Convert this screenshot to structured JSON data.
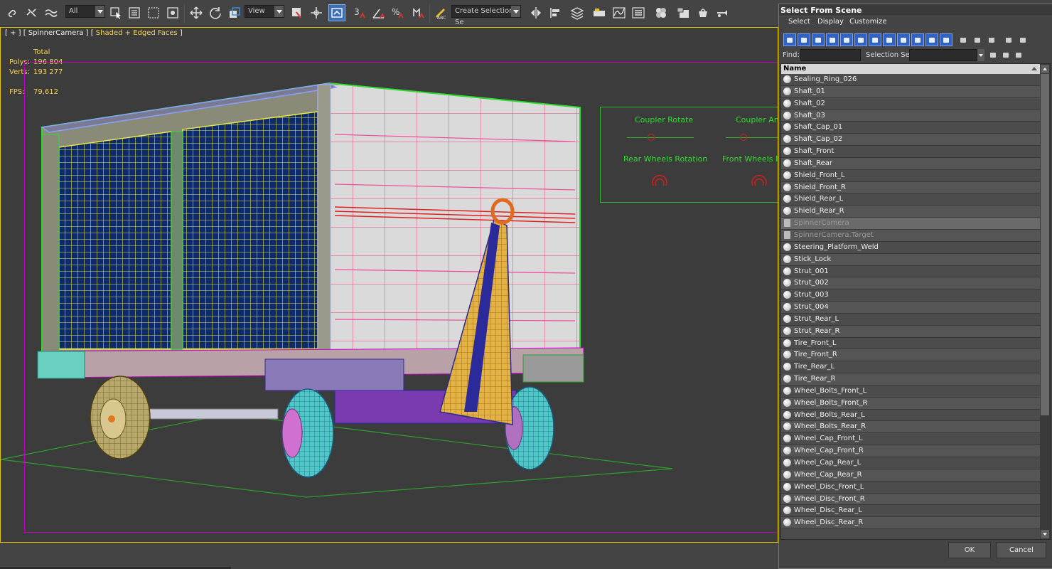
{
  "toolbar": {
    "selection_filter": "All",
    "reference_coordinate": "View",
    "named_selection_placeholder": "Create Selection Se",
    "snap_angle_label": "3",
    "percent_label": "%"
  },
  "viewport": {
    "label_prefix": "[ + ] [ SpinnerCamera ] [ ",
    "label_shading": "Shaded + Edged Faces",
    "label_suffix": " ]",
    "stats": {
      "total_label": "Total",
      "polys_label": "Polys:",
      "polys_value": "196 804",
      "verts_label": "Verts:",
      "verts_value": "193 277",
      "fps_label": "FPS:",
      "fps_value": "79,612"
    },
    "controls": {
      "coupler_rotate": "Coupler Rotate",
      "coupler_angle": "Coupler Angle",
      "rear_wheels_rotation": "Rear Wheels Rotation",
      "front_wheels_rotation": "Front Wheels Rotation"
    },
    "colors": {
      "frame": "#e5c500",
      "safe_frame": "#c000c0",
      "control_green": "#2fdd2f"
    }
  },
  "dialog": {
    "title": "Select From Scene",
    "menu": [
      "Select",
      "Display",
      "Customize"
    ],
    "find_label": "Find:",
    "find_value": "",
    "selection_set_label": "Selection Set:",
    "selection_set_value": "",
    "column_name": "Name",
    "items": [
      {
        "name": "Sealing_Ring_026",
        "type": "object"
      },
      {
        "name": "Shaft_01",
        "type": "object"
      },
      {
        "name": "Shaft_02",
        "type": "object"
      },
      {
        "name": "Shaft_03",
        "type": "object"
      },
      {
        "name": "Shaft_Cap_01",
        "type": "object"
      },
      {
        "name": "Shaft_Cap_02",
        "type": "object"
      },
      {
        "name": "Shaft_Front",
        "type": "object"
      },
      {
        "name": "Shaft_Rear",
        "type": "object"
      },
      {
        "name": "Shield_Front_L",
        "type": "object"
      },
      {
        "name": "Shield_Front_R",
        "type": "object"
      },
      {
        "name": "Shield_Rear_L",
        "type": "object"
      },
      {
        "name": "Shield_Rear_R",
        "type": "object"
      },
      {
        "name": "SpinnerCamera",
        "type": "camera",
        "selected": true
      },
      {
        "name": "SpinnerCamera.Target",
        "type": "camera"
      },
      {
        "name": "Steering_Platform_Weld",
        "type": "object"
      },
      {
        "name": "Stick_Lock",
        "type": "object"
      },
      {
        "name": "Strut_001",
        "type": "object"
      },
      {
        "name": "Strut_002",
        "type": "object"
      },
      {
        "name": "Strut_003",
        "type": "object"
      },
      {
        "name": "Strut_004",
        "type": "object"
      },
      {
        "name": "Strut_Rear_L",
        "type": "object"
      },
      {
        "name": "Strut_Rear_R",
        "type": "object"
      },
      {
        "name": "Tire_Front_L",
        "type": "object"
      },
      {
        "name": "Tire_Front_R",
        "type": "object"
      },
      {
        "name": "Tire_Rear_L",
        "type": "object"
      },
      {
        "name": "Tire_Rear_R",
        "type": "object"
      },
      {
        "name": "Wheel_Bolts_Front_L",
        "type": "object"
      },
      {
        "name": "Wheel_Bolts_Front_R",
        "type": "object"
      },
      {
        "name": "Wheel_Bolts_Rear_L",
        "type": "object"
      },
      {
        "name": "Wheel_Bolts_Rear_R",
        "type": "object"
      },
      {
        "name": "Wheel_Cap_Front_L",
        "type": "object"
      },
      {
        "name": "Wheel_Cap_Front_R",
        "type": "object"
      },
      {
        "name": "Wheel_Cap_Rear_L",
        "type": "object"
      },
      {
        "name": "Wheel_Cap_Rear_R",
        "type": "object"
      },
      {
        "name": "Wheel_Disc_Front_L",
        "type": "object"
      },
      {
        "name": "Wheel_Disc_Front_R",
        "type": "object"
      },
      {
        "name": "Wheel_Disc_Rear_L",
        "type": "object"
      },
      {
        "name": "Wheel_Disc_Rear_R",
        "type": "object"
      }
    ],
    "ok_label": "OK",
    "cancel_label": "Cancel"
  }
}
